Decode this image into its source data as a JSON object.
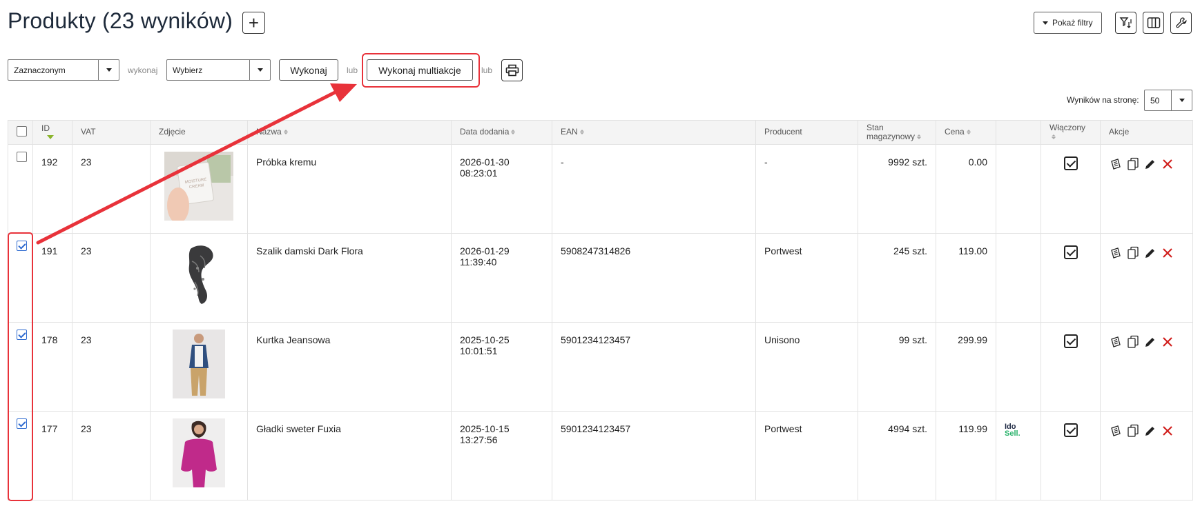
{
  "header": {
    "title": "Produkty (23 wyników)",
    "add_label": "+",
    "show_filters_label": "Pokaż filtry"
  },
  "toolbar": {
    "scope_select_value": "Zaznaczonym",
    "do_label": "wykonaj",
    "action_select_value": "Wybierz",
    "execute_label": "Wykonaj",
    "or_label_1": "lub",
    "multiaction_label": "Wykonaj multiakcje",
    "or_label_2": "lub",
    "per_page_label": "Wyników na stronę:",
    "per_page_value": "50"
  },
  "table": {
    "columns": [
      "ID",
      "VAT",
      "Zdjęcie",
      "Nazwa",
      "Data dodania",
      "EAN",
      "Producent",
      "Stan magazynowy",
      "Cena",
      "",
      "Włączony",
      "Akcje"
    ],
    "column_lines": {
      "stock_line1": "Stan",
      "stock_line2": "magazynowy",
      "name_visible": "Nazwa"
    },
    "rows": [
      {
        "id": "192",
        "vat": "23",
        "name": "Próbka kremu",
        "date1": "2026-01-30",
        "date2": "08:23:01",
        "ean": "-",
        "producer": "-",
        "stock": "9992 szt.",
        "price": "0.00",
        "checked": false,
        "thumb_text1": "MOISTURE",
        "thumb_text2": "CREAM"
      },
      {
        "id": "191",
        "vat": "23",
        "name": "Szalik damski Dark Flora",
        "date1": "2026-01-29",
        "date2": "11:39:40",
        "ean": "5908247314826",
        "producer": "Portwest",
        "stock": "245 szt.",
        "price": "119.00",
        "checked": true
      },
      {
        "id": "178",
        "vat": "23",
        "name": "Kurtka Jeansowa",
        "date1": "2025-10-25",
        "date2": "10:01:51",
        "ean": "5901234123457",
        "producer": "Unisono",
        "stock": "99 szt.",
        "price": "299.99",
        "checked": true
      },
      {
        "id": "177",
        "vat": "23",
        "name": "Gładki sweter Fuxia",
        "date1": "2025-10-15",
        "date2": "13:27:56",
        "ean": "5901234123457",
        "producer": "Portwest",
        "stock": "4994 szt.",
        "price": "119.99",
        "checked": true,
        "badge1": "Ido",
        "badge2": "Sell."
      }
    ]
  },
  "colors": {
    "accent_red": "#e8323a",
    "checkbox_blue": "#2f6bd0",
    "sort_active": "#8ab42c"
  },
  "icons": [
    "filter-sort-icon",
    "columns-icon",
    "wrench-icon",
    "printer-icon",
    "description-icon",
    "copy-icon",
    "edit-pencil-icon",
    "delete-x-icon"
  ]
}
